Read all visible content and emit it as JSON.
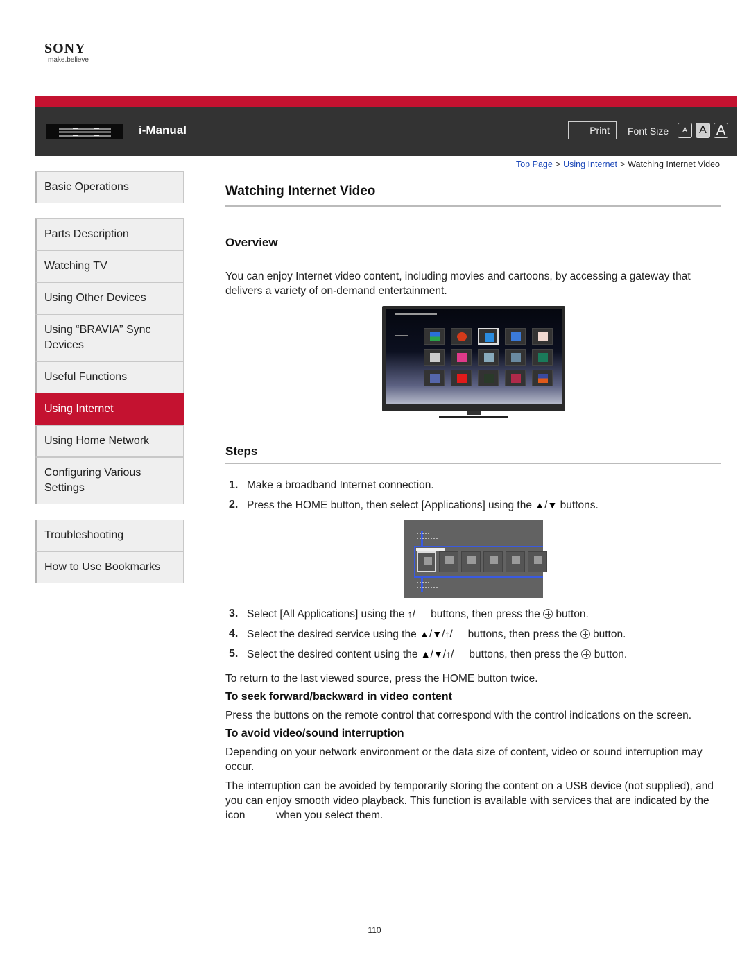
{
  "brand": {
    "name": "SONY",
    "tagline": "make.believe"
  },
  "header": {
    "title": "i-Manual",
    "print_label": "Print",
    "font_size_label": "Font Size",
    "font_size_options": [
      "A",
      "A",
      "A"
    ],
    "selected_font_size": "medium",
    "accent_color": "#c41230"
  },
  "breadcrumb": {
    "items": [
      {
        "label": "Top Page",
        "link": true
      },
      {
        "label": "Using Internet",
        "link": true
      },
      {
        "label": "Watching Internet Video",
        "link": false
      }
    ],
    "separator": ">"
  },
  "sidebar": {
    "groups": [
      [
        {
          "label": "Basic Operations"
        }
      ],
      [
        {
          "label": "Parts Description"
        },
        {
          "label": "Watching TV"
        },
        {
          "label": "Using Other Devices"
        },
        {
          "label": "Using “BRAVIA” Sync Devices"
        },
        {
          "label": "Useful Functions"
        },
        {
          "label": "Using Internet",
          "active": true
        },
        {
          "label": "Using Home Network"
        },
        {
          "label": "Configuring Various Settings"
        }
      ],
      [
        {
          "label": "Troubleshooting"
        },
        {
          "label": "How to Use Bookmarks"
        }
      ]
    ]
  },
  "content": {
    "title": "Watching Internet Video",
    "overview_heading": "Overview",
    "overview_text": "You can enjoy Internet video content, including movies and cartoons, by accessing a gateway that delivers a variety of on-demand entertainment.",
    "steps_heading": "Steps",
    "steps": {
      "s1": {
        "num": "1.",
        "text": "Make a broadband Internet connection."
      },
      "s2": {
        "num": "2.",
        "pre": "Press the HOME button, then select [Applications] using the",
        "post": "buttons."
      },
      "s3": {
        "num": "3.",
        "pre": "Select [All Applications] using the",
        "mid": "buttons, then press the",
        "post": "button."
      },
      "s4": {
        "num": "4.",
        "pre": "Select the desired service using the",
        "mid": "buttons, then press the",
        "post": "button."
      },
      "s5": {
        "num": "5.",
        "pre": "Select the desired content using the",
        "mid": "buttons, then press the",
        "post": "button."
      }
    },
    "arrows": {
      "up": "▲",
      "down": "▼",
      "up_thin": "↑",
      "slash": "/"
    },
    "return_note": "To return to the last viewed source, press the HOME button twice.",
    "seek_heading": "To seek forward/backward in video content",
    "seek_text": "Press the buttons on the remote control that correspond with the control indications on the screen.",
    "avoid_heading": "To avoid video/sound interruption",
    "avoid_text1": "Depending on your network environment or the data size of content, video or sound interruption may occur.",
    "avoid_text2_pre": "The interruption can be avoided by temporarily storing the content on a USB device (not supplied), and you can enjoy smooth video playback. This function is available with services that are indicated by the icon",
    "avoid_text2_post": "when you select them."
  },
  "page_number": "110"
}
